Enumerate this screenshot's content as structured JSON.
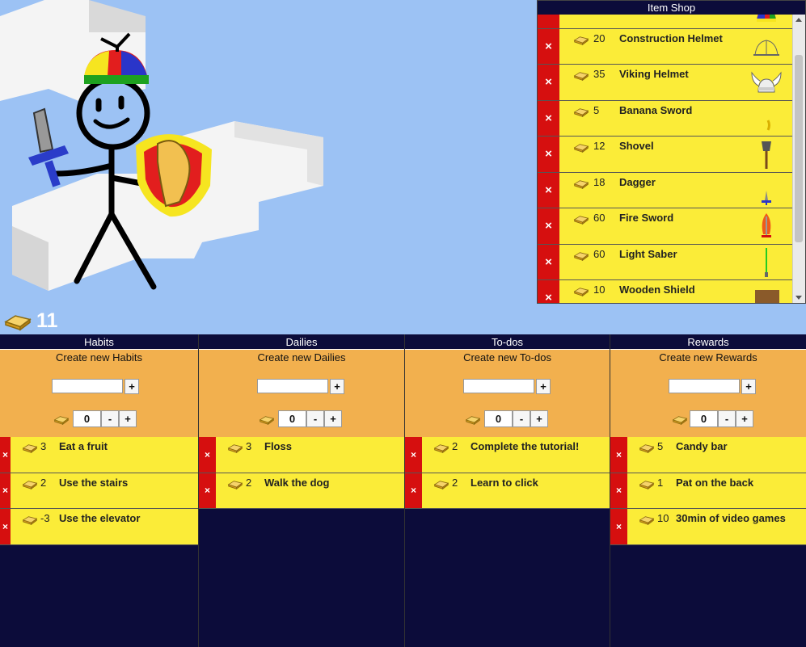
{
  "gold": "11",
  "shop": {
    "title": "Item Shop",
    "items": [
      {
        "price": "",
        "name": "",
        "icon": "propeller-hat-icon"
      },
      {
        "price": "20",
        "name": "Construction Helmet",
        "icon": "construction-helmet-icon"
      },
      {
        "price": "35",
        "name": "Viking Helmet",
        "icon": "viking-helmet-icon"
      },
      {
        "price": "5",
        "name": "Banana Sword",
        "icon": "banana-sword-icon"
      },
      {
        "price": "12",
        "name": "Shovel",
        "icon": "shovel-icon"
      },
      {
        "price": "18",
        "name": "Dagger",
        "icon": "dagger-icon"
      },
      {
        "price": "60",
        "name": "Fire Sword",
        "icon": "fire-sword-icon"
      },
      {
        "price": "60",
        "name": "Light Saber",
        "icon": "light-saber-icon"
      },
      {
        "price": "10",
        "name": "Wooden Shield",
        "icon": "wooden-shield-icon"
      }
    ]
  },
  "columns": {
    "habits": {
      "title": "Habits",
      "create": "Create new Habits",
      "count": "0",
      "items": [
        {
          "value": "3",
          "name": "Eat a fruit"
        },
        {
          "value": "2",
          "name": "Use the stairs"
        },
        {
          "value": "-3",
          "name": "Use the elevator"
        }
      ]
    },
    "dailies": {
      "title": "Dailies",
      "create": "Create new Dailies",
      "count": "0",
      "items": [
        {
          "value": "3",
          "name": "Floss"
        },
        {
          "value": "2",
          "name": "Walk the dog"
        }
      ]
    },
    "todos": {
      "title": "To-dos",
      "create": "Create new To-dos",
      "count": "0",
      "items": [
        {
          "value": "2",
          "name": "Complete the tutorial!"
        },
        {
          "value": "2",
          "name": "Learn to click"
        }
      ]
    },
    "rewards": {
      "title": "Rewards",
      "create": "Create new Rewards",
      "count": "0",
      "items": [
        {
          "value": "5",
          "name": "Candy bar"
        },
        {
          "value": "1",
          "name": "Pat on the back"
        },
        {
          "value": "10",
          "name": "30min of video games"
        }
      ]
    }
  },
  "buttons": {
    "plus": "+",
    "minus": "-",
    "remove": "×"
  },
  "colors": {
    "row_bg": "#fbec38",
    "remove_bg": "#d60f0f",
    "create_bg": "#f2b04e",
    "panel_bg": "#0c0c3a",
    "sky": "#9cc2f4"
  }
}
